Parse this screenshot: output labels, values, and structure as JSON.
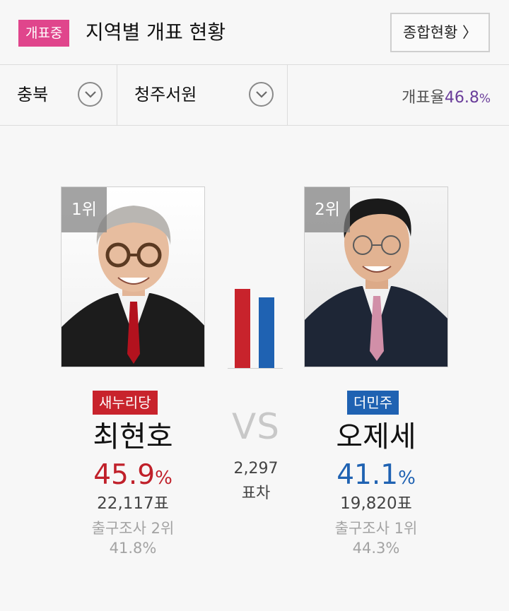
{
  "header": {
    "badge": "개표중",
    "title": "지역별 개표 현황",
    "summary_button": "종합현황 〉"
  },
  "filters": {
    "region": "충북",
    "district": "청주서원",
    "rate_label": "개표율",
    "rate_value": "46.8",
    "rate_unit": "%"
  },
  "colors": {
    "live_badge": "#e0458c",
    "saenuri": "#c8232c",
    "minjoo": "#1f62b2",
    "rate": "#6a3d9a"
  },
  "matchup": {
    "vs": "VS",
    "gap_votes": "2,297",
    "gap_label": "표차"
  },
  "chart_data": {
    "type": "bar",
    "categories": [
      "최현호",
      "오제세"
    ],
    "values": [
      45.9,
      41.1
    ],
    "colors": [
      "#c8232c",
      "#1f62b2"
    ]
  },
  "candidates": [
    {
      "rank": "1위",
      "party": "새누리당",
      "name": "최현호",
      "percent": "45.9",
      "percent_unit": "%",
      "votes": "22,117표",
      "exit_poll": "출구조사 2위",
      "exit_pct": "41.8%"
    },
    {
      "rank": "2위",
      "party": "더민주",
      "name": "오제세",
      "percent": "41.1",
      "percent_unit": "%",
      "votes": "19,820표",
      "exit_poll": "출구조사 1위",
      "exit_pct": "44.3%"
    }
  ]
}
